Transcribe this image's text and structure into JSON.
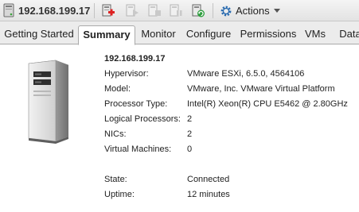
{
  "header": {
    "host_ip": "192.168.199.17",
    "actions_label": "Actions",
    "icons": [
      "host-icon",
      "add-vm-icon",
      "power-on-icon",
      "power-off-icon",
      "suspend-icon",
      "migrate-icon",
      "actions-gear-icon"
    ]
  },
  "tabs": [
    {
      "label": "Getting Started"
    },
    {
      "label": "Summary",
      "active": true
    },
    {
      "label": "Monitor"
    },
    {
      "label": "Configure"
    },
    {
      "label": "Permissions"
    },
    {
      "label": "VMs"
    },
    {
      "label": "Data"
    }
  ],
  "summary": {
    "title": "192.168.199.17",
    "rows": [
      {
        "label": "Hypervisor:",
        "value": "VMware ESXi, 6.5.0, 4564106"
      },
      {
        "label": "Model:",
        "value": "VMware, Inc. VMware Virtual Platform"
      },
      {
        "label": "Processor Type:",
        "value": "Intel(R) Xeon(R) CPU E5462 @ 2.80GHz"
      },
      {
        "label": "Logical Processors:",
        "value": "2"
      },
      {
        "label": "NICs:",
        "value": "2"
      },
      {
        "label": "Virtual Machines:",
        "value": "0"
      }
    ],
    "status_rows": [
      {
        "label": "State:",
        "value": "Connected"
      },
      {
        "label": "Uptime:",
        "value": "12 minutes"
      }
    ]
  },
  "colors": {
    "accent_blue": "#2b6cb0",
    "tab_bar": "#ececec"
  }
}
